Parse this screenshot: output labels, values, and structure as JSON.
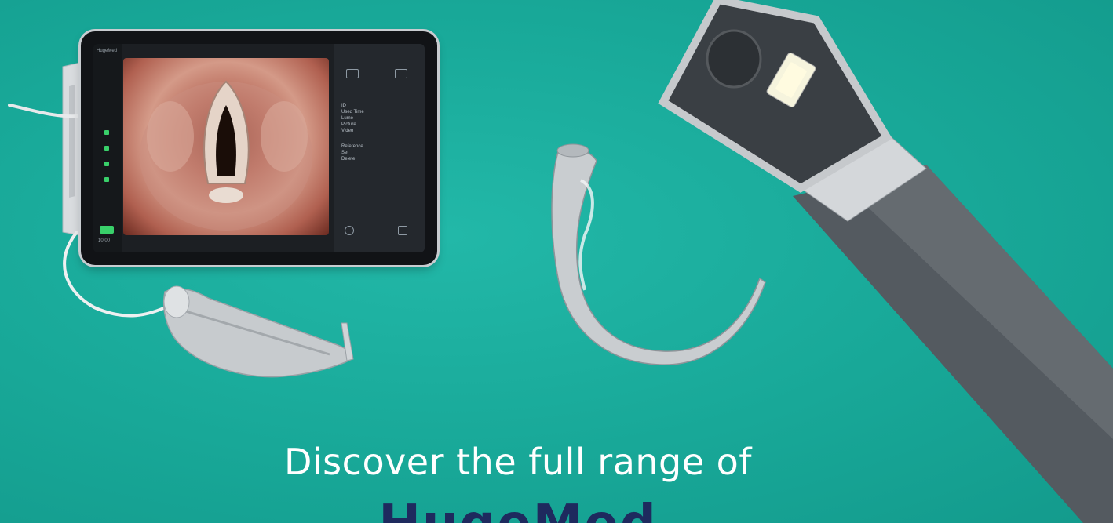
{
  "headline": "Discover the full range of",
  "brand": "HugeMed",
  "colors": {
    "background": "#1aaa9c",
    "headline_text": "#ffffff",
    "brand_text": "#1e2a5e"
  },
  "tablet": {
    "rail_label": "HugeMed",
    "rail_bottom_label": "10:00",
    "panel_rows": [
      "ID",
      "Used Time",
      "Lume",
      "Picture",
      "Video",
      "Reference",
      "Set",
      "Delete"
    ],
    "icons": [
      "video-camera-icon",
      "folder-icon",
      "power-icon",
      "grid-icon"
    ]
  }
}
